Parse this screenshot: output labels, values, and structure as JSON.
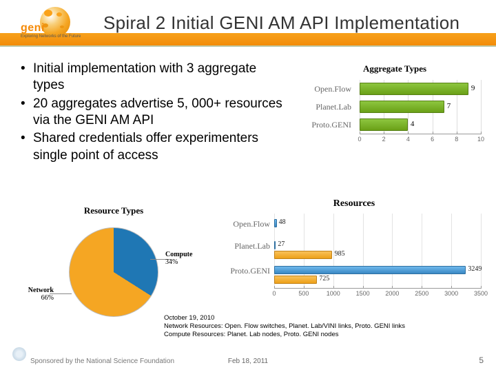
{
  "header": {
    "title": "Spiral 2 Initial GENI AM API Implementation",
    "logo_text": "geni",
    "logo_tag": "Exploring Networks of the Future"
  },
  "bullets": [
    "Initial implementation with 3 aggregate types",
    "20 aggregates advertise 5, 000+ resources via the GENI AM API",
    "Shared credentials offer experimenters single point of access"
  ],
  "note": {
    "line1": "October 19, 2010",
    "line2": "Network Resources: Open. Flow switches, Planet. Lab/VINI links, Proto. GENI links",
    "line3": "Compute Resources: Planet. Lab nodes, Proto. GENI nodes"
  },
  "footer": {
    "sponsor": "Sponsored by the National Science Foundation",
    "date": "Feb 18, 2011",
    "page": "5"
  },
  "chart_data": [
    {
      "type": "bar",
      "orientation": "horizontal",
      "title": "Aggregate Types",
      "categories": [
        "Open.Flow",
        "Planet.Lab",
        "Proto.GENI"
      ],
      "values": [
        9,
        7,
        4
      ],
      "xlim": [
        0,
        10
      ],
      "xticks": [
        0,
        2,
        4,
        6,
        8,
        10
      ]
    },
    {
      "type": "pie",
      "title": "Resource Types",
      "slices": [
        {
          "name": "Network",
          "pct": 66
        },
        {
          "name": "Compute",
          "pct": 34
        }
      ]
    },
    {
      "type": "bar",
      "orientation": "horizontal",
      "title": "Resources",
      "categories": [
        "Open.Flow",
        "Planet.Lab",
        "Proto.GENI"
      ],
      "series": [
        {
          "name": "Network",
          "values": [
            48,
            27,
            3249
          ]
        },
        {
          "name": "Compute",
          "values": [
            null,
            985,
            725
          ]
        }
      ],
      "xlim": [
        0,
        3500
      ],
      "xticks": [
        0,
        500,
        1000,
        1500,
        2000,
        2500,
        3000,
        3500
      ]
    }
  ],
  "labels": {
    "agg_title": "Aggregate Types",
    "pie_title": "Resource Types",
    "res_title": "Resources",
    "cat_of": "Open.Flow",
    "cat_pl": "Planet.Lab",
    "cat_pg": "Proto.GENI",
    "pie_net_label": "Network",
    "pie_net_pct": "66%",
    "pie_cmp_label": "Compute",
    "pie_cmp_pct": "34%"
  }
}
